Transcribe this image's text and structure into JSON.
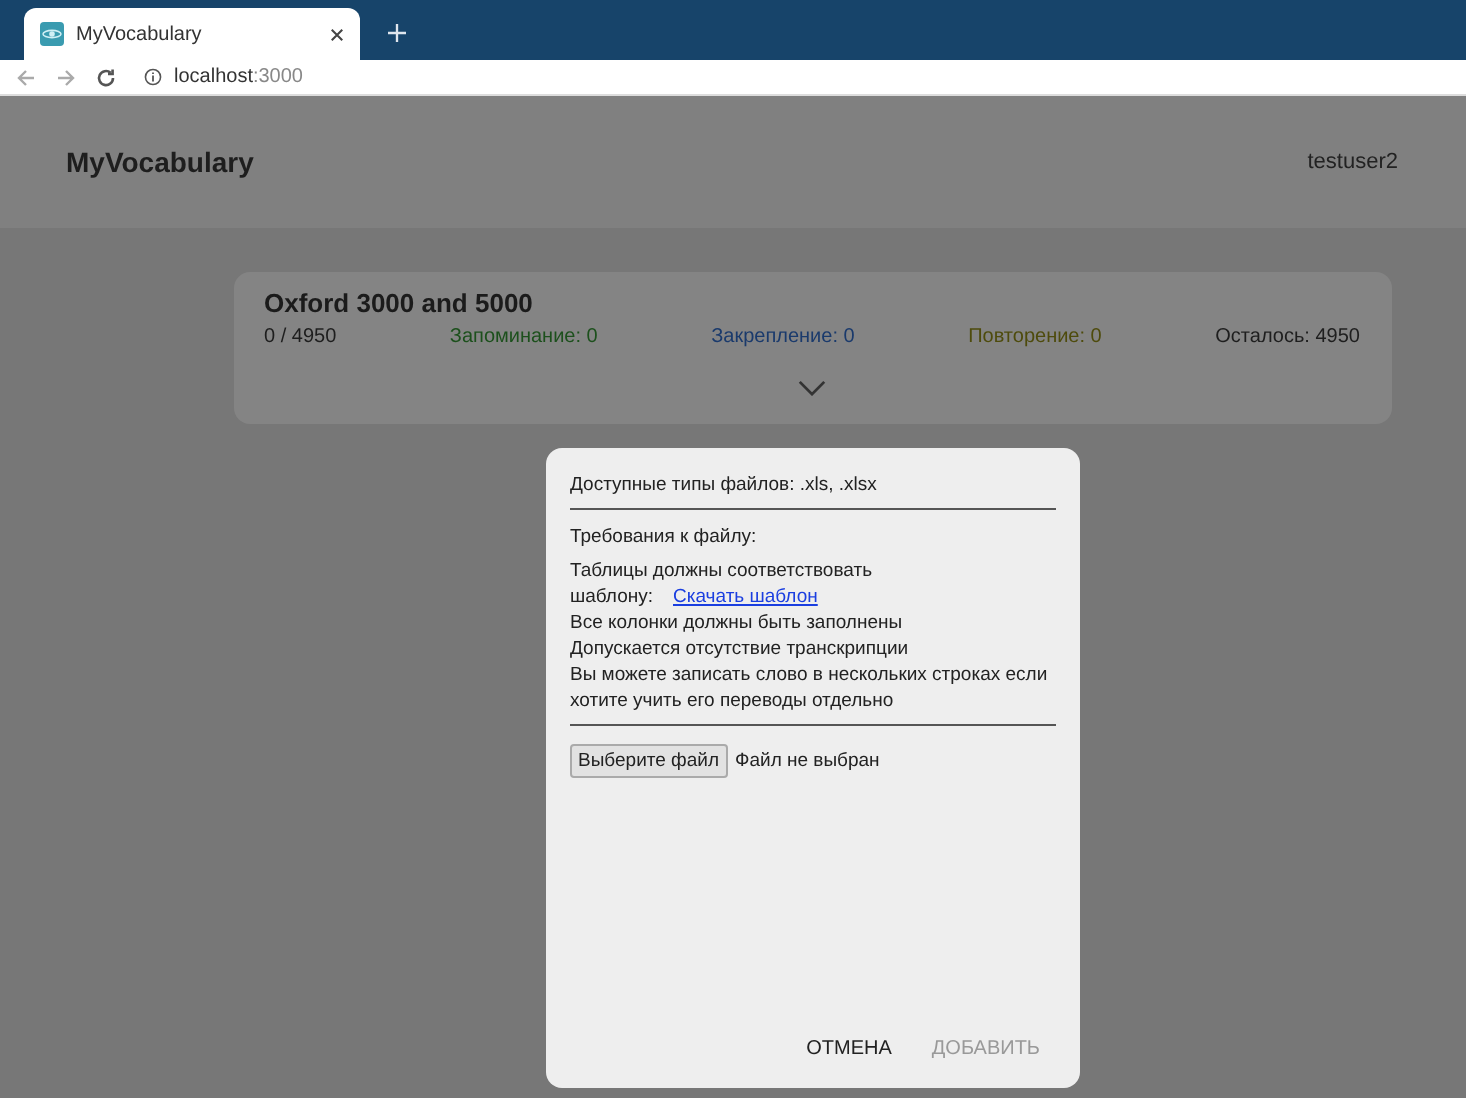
{
  "browser": {
    "tab_title": "MyVocabulary",
    "url_host": "localhost",
    "url_port": ":3000"
  },
  "app": {
    "title": "MyVocabulary",
    "user": "testuser2"
  },
  "deck": {
    "name": "Oxford 3000 and 5000",
    "progress": "0 / 4950",
    "stats": [
      {
        "label": "Запоминание: 0",
        "color": "#1c501c"
      },
      {
        "label": "Закрепление: 0",
        "color": "#1a3a6c"
      },
      {
        "label": "Повторение: 0",
        "color": "#4e4b0c"
      }
    ],
    "remaining": "Осталось: 4950"
  },
  "dialog": {
    "file_types": "Доступные типы файлов: .xls, .xlsx",
    "requirements_title": "Требования к файлу:",
    "requirements": [
      {
        "text": "Таблицы должны соответствовать"
      },
      {
        "text": "шаблону:",
        "link": "Скачать шаблон"
      },
      {
        "text": "Все колонки должны быть заполнены"
      },
      {
        "text": "Допускается отсутствие транскрипции"
      },
      {
        "text": "Вы можете записать слово в нескольких строках если"
      },
      {
        "text": "хотите учить его переводы отдельно"
      }
    ],
    "file_button": "Выберите файл",
    "file_status": "Файл не выбран",
    "buttons": [
      {
        "label": "ОТМЕНА",
        "disabled": false
      },
      {
        "label": "ДОБАВИТЬ",
        "disabled": true
      }
    ]
  }
}
